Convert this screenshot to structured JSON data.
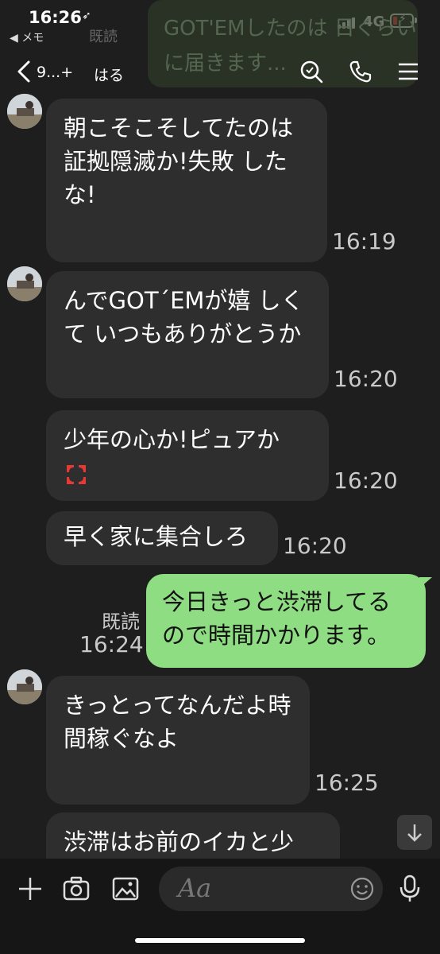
{
  "status_bar": {
    "time": "16:26",
    "location_arrow": "➶",
    "back_app": "◀ メモ",
    "network": "4G"
  },
  "header": {
    "chat_name": "9...+",
    "partner_name": "はる",
    "background_read_label": "既読",
    "background_text": "GOT'EMしたのは 日くらいに届きます..."
  },
  "messages": [
    {
      "id": "m1",
      "sender": "other",
      "text": "朝こそこそしてたのは 証拠隠滅か!失敗 したな!",
      "time": "16:19",
      "has_avatar": true
    },
    {
      "id": "m2",
      "sender": "other",
      "text": "んでGOT´EMが嬉 しくて いつもありがとうか",
      "time": "16:20",
      "has_avatar": true
    },
    {
      "id": "m3",
      "sender": "other",
      "text": "少年の心か!ピュアか",
      "time": "16:20",
      "has_avatar": false,
      "emoji": "anger-symbol"
    },
    {
      "id": "m4",
      "sender": "other",
      "text": "早く家に集合しろ",
      "time": "16:20",
      "has_avatar": false
    },
    {
      "id": "m5",
      "sender": "me",
      "text": "今日きっと渋滞してる ので時間かかります。",
      "time": "16:24",
      "read": "既読"
    },
    {
      "id": "m6",
      "sender": "other",
      "text": "きっとってなんだよ時 間稼ぐなよ",
      "time": "16:25",
      "has_avatar": true
    },
    {
      "id": "m7",
      "sender": "other",
      "text": "渋滞はお前のイカと少",
      "time": "",
      "has_avatar": false
    }
  ],
  "input": {
    "placeholder": "Aa"
  },
  "icons": {
    "search": "search-icon",
    "call": "phone-icon",
    "menu": "menu-icon",
    "add": "plus-icon",
    "camera": "camera-icon",
    "image": "image-icon",
    "sticker": "smiley-icon",
    "mic": "microphone-icon",
    "scroll": "arrow-down-icon"
  },
  "colors": {
    "background": "#1e1e1e",
    "bubble_other": "#2e2e2e",
    "bubble_me": "#8fdd82",
    "battery_low": "#ff3b30"
  }
}
